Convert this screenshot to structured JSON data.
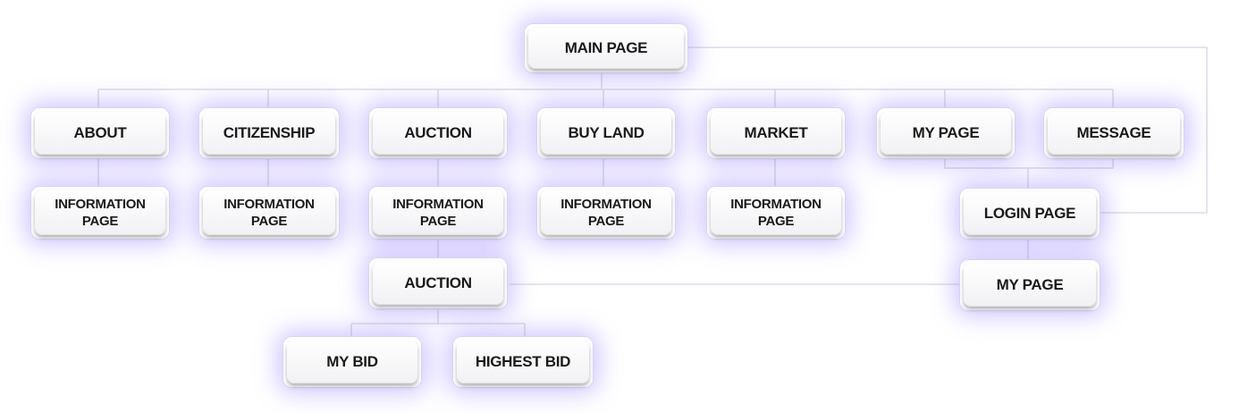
{
  "sitemap": {
    "main": "MAIN PAGE",
    "about": "ABOUT",
    "citizenship": "CITIZENSHIP",
    "auction": "AUCTION",
    "buy_land": "BUY LAND",
    "market": "MARKET",
    "my_page": "MY PAGE",
    "message": "MESSAGE",
    "info_about": "INFORMATION\nPAGE",
    "info_citizenship": "INFORMATION\nPAGE",
    "info_auction": "INFORMATION\nPAGE",
    "info_buy_land": "INFORMATION\nPAGE",
    "info_market": "INFORMATION\nPAGE",
    "auction_detail": "AUCTION",
    "my_bid": "MY BID",
    "highest_bid": "HIGHEST BID",
    "login_page": "LOGIN PAGE",
    "login_my_page": "MY PAGE"
  },
  "colors": {
    "glow": "#9278ff",
    "node_border": "#d9d3f6",
    "connector": "#dcdcea",
    "text": "#1a1a1a"
  }
}
